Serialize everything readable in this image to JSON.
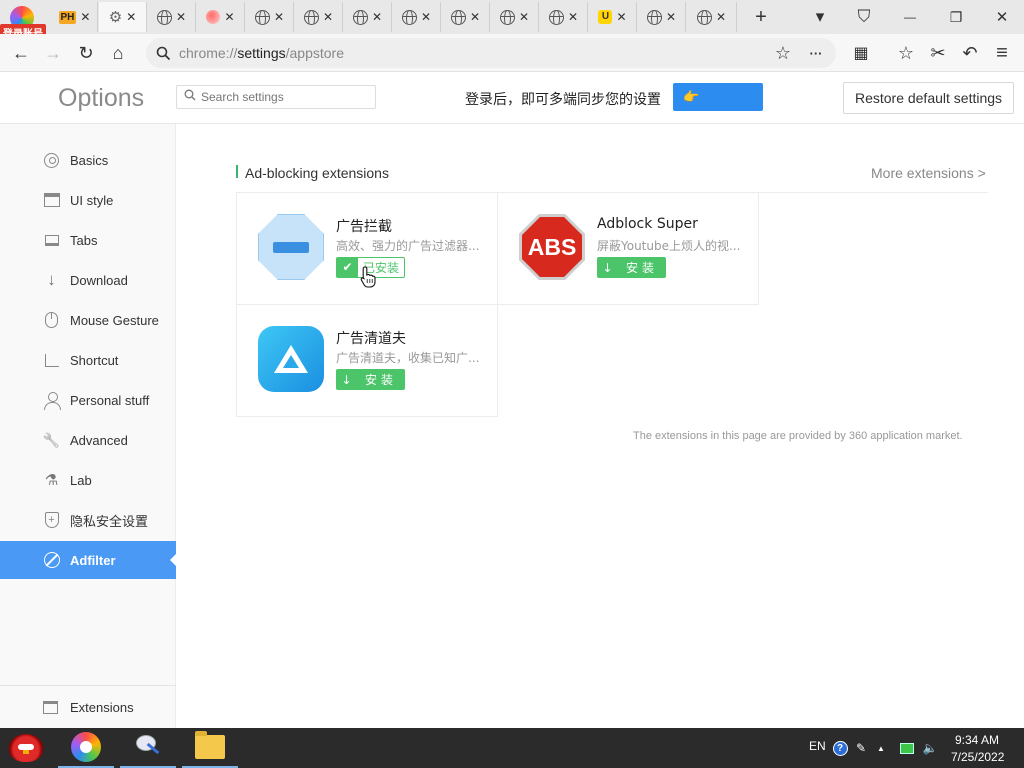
{
  "tabs": {
    "login_badge": "登录账号",
    "ph_label": "PH",
    "close_glyph": "✕",
    "new_tab_glyph": "+",
    "u_label": "U",
    "controls": {
      "menu_glyph": "▾",
      "shirt_glyph": "⛉",
      "minimize_glyph": "—",
      "restore_glyph": "❐",
      "close_glyph": "✕"
    }
  },
  "toolbar": {
    "back_glyph": "←",
    "forward_glyph": "→",
    "reload_glyph": "↻",
    "home_glyph": "⌂",
    "url_scheme": "chrome://",
    "url_host": "settings",
    "url_path": "/appstore",
    "star_glyph": "☆",
    "more_glyph": "···",
    "apps_glyph": "▦",
    "favorites_glyph": "☆",
    "scissors_glyph": "✂",
    "undo_glyph": "↶",
    "menu_glyph": "≡"
  },
  "header": {
    "title": "Options",
    "search_placeholder": "Search settings",
    "sync_text": "登录后，即可多端同步您的设置",
    "sync_button_glyph": "👉",
    "restore_button": "Restore default settings"
  },
  "sidebar": {
    "items": [
      {
        "label": "Basics",
        "icon": "settings-circle-icon"
      },
      {
        "label": "UI style",
        "icon": "window-icon"
      },
      {
        "label": "Tabs",
        "icon": "tab-icon"
      },
      {
        "label": "Download",
        "icon": "download-icon"
      },
      {
        "label": "Mouse Gesture",
        "icon": "mouse-icon"
      },
      {
        "label": "Shortcut",
        "icon": "shortcut-icon"
      },
      {
        "label": "Personal stuff",
        "icon": "person-icon"
      },
      {
        "label": "Advanced",
        "icon": "wrench-icon"
      },
      {
        "label": "Lab",
        "icon": "flask-icon"
      },
      {
        "label": "隐私安全设置",
        "icon": "shield-icon"
      },
      {
        "label": "Adfilter",
        "icon": "block-icon",
        "active": true
      }
    ],
    "extensions_label": "Extensions",
    "download_glyph": "↓",
    "wrench_glyph": "🔧",
    "flask_glyph": "⚗",
    "plus_glyph": "+"
  },
  "main": {
    "section_title": "Ad-blocking extensions",
    "more_link": "More extensions >",
    "cards": [
      {
        "title": "广告拦截",
        "description": "高效、强力的广告过滤器...",
        "button": "已安装",
        "button_icon": "✔",
        "state": "installed"
      },
      {
        "title": "Adblock Super",
        "description": "屏蔽Youtube上烦人的视...",
        "button": "安装",
        "button_icon": "↓",
        "state": "available",
        "logo_text": "ABS"
      },
      {
        "title": "广告清道夫",
        "description": "广告清道夫，收集已知广...",
        "button": "安装",
        "button_icon": "↓",
        "state": "available"
      }
    ],
    "footnote": "The extensions in this page are provided by 360 application market."
  },
  "taskbar": {
    "language": "EN",
    "help_glyph": "?",
    "pen_glyph": "✎",
    "arrow_up_glyph": "▲",
    "volume_glyph": "🔈",
    "time": "9:34 AM",
    "date": "7/25/2022"
  },
  "colors": {
    "accent_blue": "#4a9af5",
    "install_green": "#4cc46a",
    "section_bar_green": "#3cb371",
    "abs_red": "#d8291f"
  }
}
